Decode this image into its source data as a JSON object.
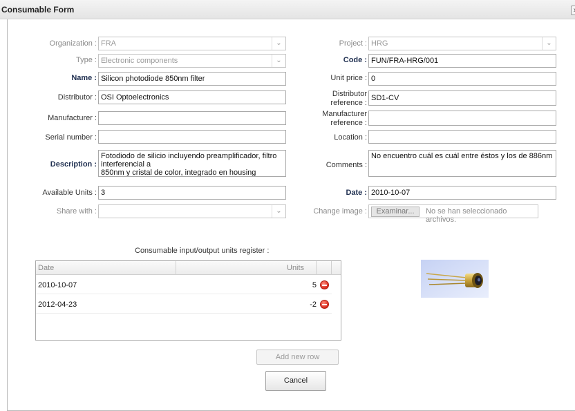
{
  "window": {
    "title": "Consumable Form"
  },
  "form": {
    "organization": {
      "label": "Organization :",
      "value": "FRA"
    },
    "type": {
      "label": "Type :",
      "value": "Electronic components"
    },
    "name": {
      "label": "Name :",
      "value": "Silicon photodiode 850nm filter"
    },
    "distributor": {
      "label": "Distributor :",
      "value": "OSI Optoelectronics"
    },
    "manufacturer": {
      "label": "Manufacturer :",
      "value": ""
    },
    "serial_number": {
      "label": "Serial number :",
      "value": ""
    },
    "description": {
      "label": "Description :",
      "value": "Fotodiodo de silicio incluyendo preamplificador, filtro interferencial a\n850nm y cristal de color, integrado en housing"
    },
    "available_units": {
      "label": "Available Units :",
      "value": "3"
    },
    "share_with": {
      "label": "Share with :",
      "value": ""
    },
    "project": {
      "label": "Project :",
      "value": "HRG"
    },
    "code": {
      "label": "Code :",
      "value": "FUN/FRA-HRG/001"
    },
    "unit_price": {
      "label": "Unit price :",
      "value": "0"
    },
    "distributor_reference": {
      "label_line1": "Distributor",
      "label_line2": "reference :",
      "value": "SD1-CV"
    },
    "manufacturer_reference": {
      "label_line1": "Manufacturer",
      "label_line2": "reference :",
      "value": ""
    },
    "location": {
      "label": "Location :",
      "value": ""
    },
    "comments": {
      "label": "Comments :",
      "value": "No encuentro cuál es cuál entre éstos y los de 886nm"
    },
    "date": {
      "label": "Date :",
      "value": "2010-10-07"
    },
    "change_image": {
      "label": "Change image :",
      "button": "Examinar...",
      "status": "No se han seleccionado archivos."
    }
  },
  "units_register": {
    "caption": "Consumable input/output units register :",
    "columns": [
      "Date",
      "Units"
    ],
    "rows": [
      {
        "date": "2010-10-07",
        "units": "5"
      },
      {
        "date": "2012-04-23",
        "units": "-2"
      }
    ]
  },
  "buttons": {
    "add_row": "Add new row",
    "cancel": "Cancel"
  },
  "icons": {
    "close": "close-icon",
    "dropdown": "chevron-down-icon",
    "delete": "remove-row-icon"
  },
  "colors": {
    "label_bold": "#1f2f50",
    "delete_icon": "#d8291c"
  }
}
